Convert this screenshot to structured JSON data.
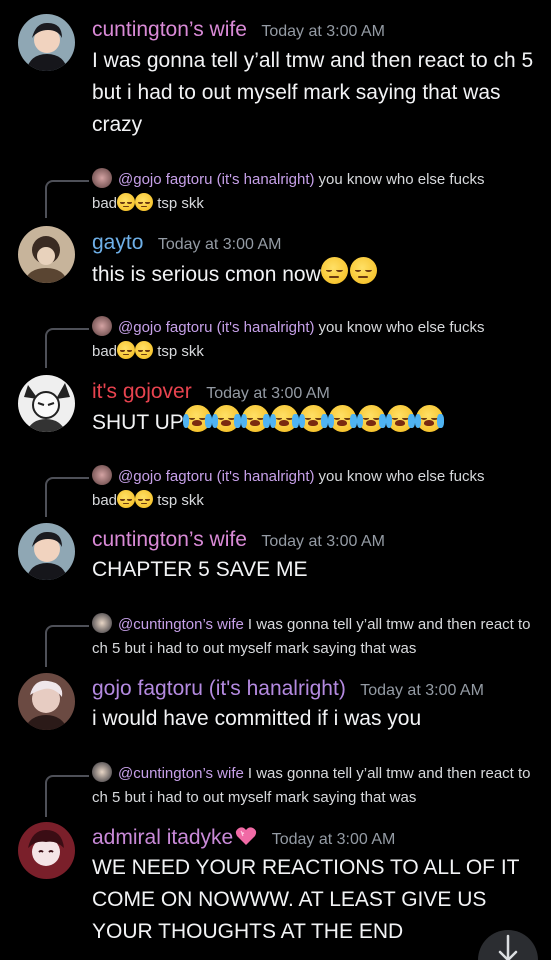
{
  "messages": [
    {
      "author": "cuntington’s wife",
      "author_color": "#d98ad6",
      "timestamp": "Today at 3:00 AM",
      "content": "I was gonna tell y’all tmw and then react to ch 5 but i had to out myself mark saying that was crazy"
    },
    {
      "reply": {
        "author": "@gojo fagtoru (it's hanalright)",
        "text_a": "you know who else fucks",
        "text_b": "bad",
        "text_c": "tsp skk"
      },
      "author": "gayto",
      "author_color": "#6fb0e8",
      "timestamp": "Today at 3:00 AM",
      "content": "this is serious cmon now"
    },
    {
      "reply": {
        "author": "@gojo fagtoru (it's hanalright)",
        "text_a": "you know who else fucks",
        "text_b": "bad",
        "text_c": "tsp skk"
      },
      "author": "it's gojover",
      "author_color": "#e8434f",
      "timestamp": "Today at 3:00 AM",
      "content": "SHUT UP"
    },
    {
      "reply": {
        "author": "@gojo fagtoru (it's hanalright)",
        "text_a": "you know who else fucks",
        "text_b": "bad",
        "text_c": "tsp skk"
      },
      "author": "cuntington’s wife",
      "author_color": "#d98ad6",
      "timestamp": "Today at 3:00 AM",
      "content": "CHAPTER 5 SAVE ME"
    },
    {
      "reply": {
        "author": "@cuntington’s wife",
        "text": "I was gonna tell y’all tmw and then react to ch 5 but i had to out myself mark saying that was"
      },
      "author": "gojo fagtoru (it's hanalright)",
      "author_color": "#b48ae0",
      "timestamp": "Today at 3:00 AM",
      "content": "i would have committed if i was you"
    },
    {
      "reply": {
        "author": "@cuntington’s wife",
        "text": "I was gonna tell y’all tmw and then react to ch 5 but i had to out myself mark saying that was"
      },
      "author": "admiral itadyke",
      "author_color": "#c98ad8",
      "timestamp": "Today at 3:00 AM",
      "content": "WE NEED YOUR REACTIONS TO ALL OF IT COME ON NOWWW. AT LEAST GIVE US YOUR THOUGHTS AT THE END"
    }
  ],
  "icons": {
    "pensive_emoji": "pensive-face",
    "crying_emoji": "loudly-crying-face",
    "heart_emoji": "sparkling-heart",
    "jump_button": "arrow-down-icon"
  }
}
